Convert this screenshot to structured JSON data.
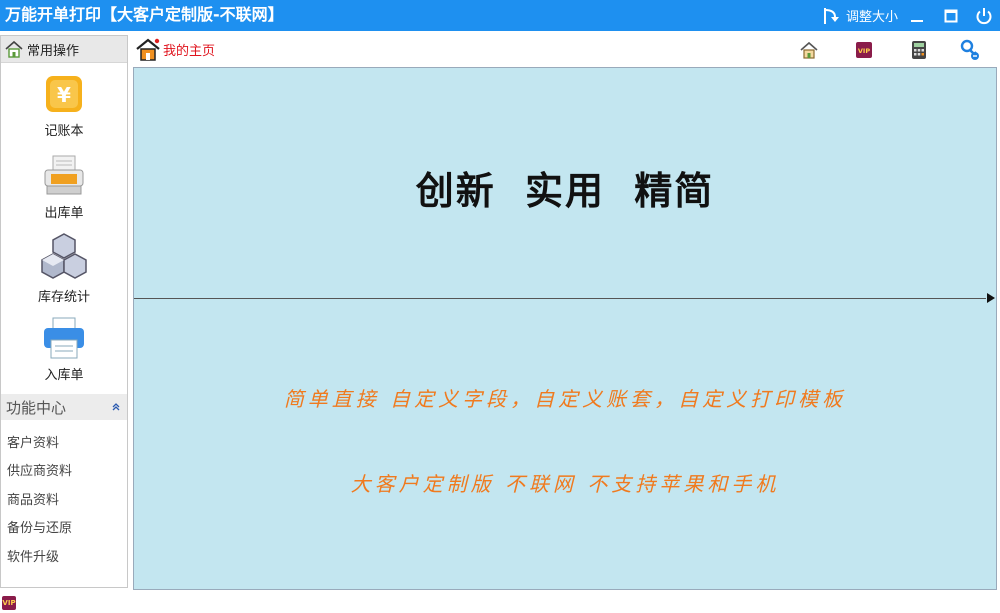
{
  "window": {
    "title": "万能开单打印【大客户定制版-不联网】",
    "resize_label": "调整大小"
  },
  "sidebar": {
    "common_header": "常用操作",
    "tools": [
      {
        "label": "记账本",
        "icon": "ledger-icon"
      },
      {
        "label": "出库单",
        "icon": "printer-out-icon"
      },
      {
        "label": "库存统计",
        "icon": "cubes-icon"
      },
      {
        "label": "入库单",
        "icon": "printer-in-icon"
      }
    ],
    "function_header": "功能中心",
    "function_items": [
      "客户资料",
      "供应商资料",
      "商品资料",
      "备份与还原",
      "软件升级"
    ]
  },
  "tabbar": {
    "home_tab": "我的主页",
    "icons": [
      "home-icon",
      "vip-icon",
      "calculator-icon",
      "user-key-icon"
    ],
    "vip_text": "VIP"
  },
  "main": {
    "slogan": "创新 实用 精简",
    "feature_line1": "简单直接 自定义字段，自定义账套，自定义打印模板",
    "feature_line2": "大客户定制版 不联网 不支持苹果和手机"
  },
  "statusbar": {
    "vip_text": "VIP"
  },
  "colors": {
    "titlebar": "#1e90f0",
    "main_bg": "#c3e6f0",
    "accent_orange": "#f07a1e",
    "home_red": "#e0141e"
  }
}
